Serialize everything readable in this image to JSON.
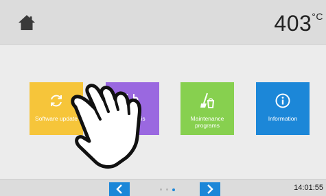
{
  "header": {
    "home_icon": "home-icon",
    "temperature_value": "403",
    "temperature_unit": "°C"
  },
  "tiles": [
    {
      "label": "Software update",
      "icon": "refresh-icon",
      "color": "#f6c53a"
    },
    {
      "label": "Diagnosis",
      "icon": "stethoscope-icon",
      "color": "#9a68e0"
    },
    {
      "label": "Maintenance programs",
      "icon": "broom-bucket-icon",
      "color": "#87d04f"
    },
    {
      "label": "Information",
      "icon": "info-icon",
      "color": "#1c87d8"
    }
  ],
  "footer": {
    "prev_icon": "chevron-left-icon",
    "next_icon": "chevron-right-icon",
    "pages": 3,
    "current_page": 3,
    "time": "14:01:55"
  },
  "overlay": {
    "icon": "pointing-hand-icon"
  }
}
